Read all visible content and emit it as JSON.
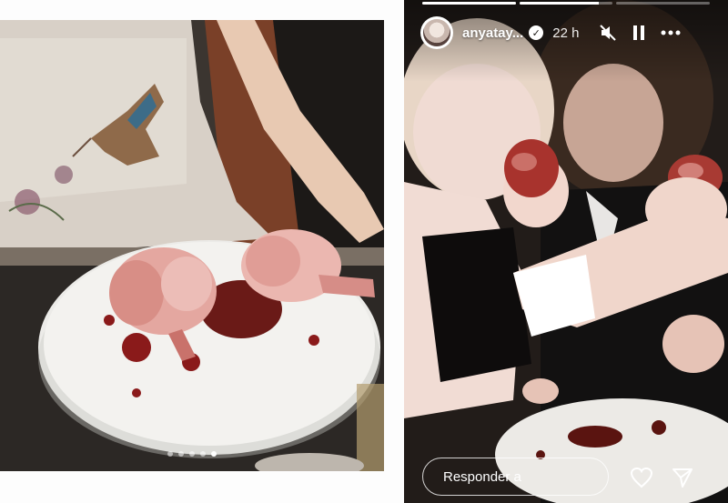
{
  "left_post": {
    "image_description": "Woman in embroidered dress behind a white plate with anatomical heart shaped cakes",
    "carousel": {
      "count": 5,
      "active_index": 4
    }
  },
  "story": {
    "progress": [
      1.0,
      0.85,
      0.0
    ],
    "username": "anyatay...",
    "time": "22 h",
    "reply_label": "Responder a"
  },
  "icons": {
    "verified": "verified-badge-icon",
    "mute": "speaker-muted-icon",
    "pause": "pause-icon",
    "more": "more-options-icon",
    "like": "heart-icon",
    "send": "send-icon"
  }
}
